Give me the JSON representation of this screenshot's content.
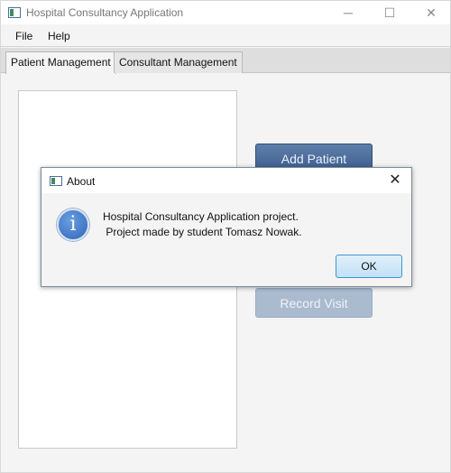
{
  "window": {
    "title": "Hospital Consultancy Application",
    "controls": {
      "minimize": "─",
      "maximize": "☐",
      "close": "✕"
    }
  },
  "menu": {
    "file": "File",
    "help": "Help"
  },
  "tabs": [
    {
      "label": "Patient Management",
      "active": true
    },
    {
      "label": "Consultant Management",
      "active": false
    }
  ],
  "buttons": {
    "add_patient": "Add Patient",
    "record_visit": "Record Visit"
  },
  "dialog": {
    "title": "About",
    "close": "✕",
    "icon": "info-icon",
    "icon_glyph": "i",
    "message_line1": "Hospital Consultancy Application project.",
    "message_line2": " Project made by student Tomasz Nowak.",
    "ok_label": "OK"
  },
  "colors": {
    "accent_button": "#3b5d8d",
    "ok_focus_border": "#3c96d2",
    "info_icon": "#2f66b8"
  }
}
